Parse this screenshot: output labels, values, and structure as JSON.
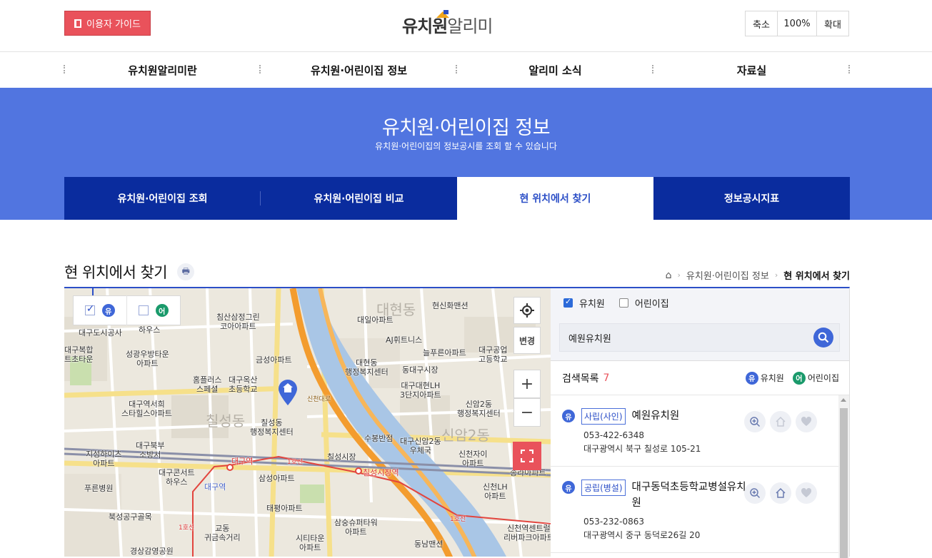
{
  "header": {
    "guide_label": "이용자 가이드",
    "logo_primary": "유치원",
    "logo_secondary": "알리미",
    "zoom_out": "축소",
    "zoom_level": "100%",
    "zoom_in": "확대"
  },
  "gnb": [
    "유치원알리미란",
    "유치원·어린이집 정보",
    "알리미 소식",
    "자료실"
  ],
  "banner": {
    "title": "유치원·어린이집 정보",
    "subtitle": "유치원·어린이집의 정보공시를 조회 할 수 있습니다",
    "tabs": [
      {
        "label": "유치원·어린이집 조회",
        "active": false
      },
      {
        "label": "유치원·어린이집 비교",
        "active": false
      },
      {
        "label": "현 위치에서 찾기",
        "active": true
      },
      {
        "label": "정보공시지표",
        "active": false
      }
    ]
  },
  "page": {
    "title": "현 위치에서 찾기",
    "breadcrumb": [
      "유치원·어린이집 정보",
      "현 위치에서 찾기"
    ]
  },
  "map": {
    "type_toggles": [
      {
        "icon": "유",
        "checked": true
      },
      {
        "icon": "어",
        "checked": false
      }
    ],
    "change_label": "변경",
    "labels": {
      "l1": "대구도시공사",
      "l2": "하우스",
      "l3": "침산삼정그린\n코아아파트",
      "l4": "대일아파트",
      "l5": "현신화맨션",
      "l6": "AJ휘트니스",
      "l7": "대구복합\n트초타운",
      "l8": "성광우방타운\n아파트",
      "l9": "금성아파트",
      "l10": "대현동\n행정복지센터",
      "l11": "늘푸른아파트",
      "l12": "대구공업\n고등학교",
      "l13": "홈플러스\n스페셜",
      "l14": "대구옥산\n초등학교",
      "l15": "동대구시장",
      "l16": "대구대현LH\n3단지아파트",
      "l17": "신암2동\n행정복지센터",
      "l18": "대구역서희\n스타힐스아파트",
      "l19": "칠성동\n행정복지센터",
      "l20": "수봉반점",
      "l21": "대구신암2동\n우체국",
      "l22": "대구북부\n소방서",
      "l23": "지성하이츠\n아파트",
      "l24": "칠성시장",
      "l25": "신천자이\n아파트",
      "l26": "대구콘서트\n하우스",
      "l27": "대구역",
      "l28": "삼성아파트",
      "l29": "칠성시장역",
      "l30": "송라아파트",
      "l31": "신천LH\n아파트",
      "l32": "푸른병원",
      "l33": "태평아파트",
      "l34": "북성공구골목",
      "l35": "교동\n귀금속거리",
      "l36": "삼숭슈퍼타워\n아파트",
      "l37": "신천역센트럴\n리버파크아파트",
      "l38": "시티타운\n아파트",
      "l39": "동남맨션",
      "l40": "경상감영공원",
      "l41": "대구역",
      "l42": "1호선",
      "l43": "1호선",
      "l44": "1호선",
      "l45": "신천대로",
      "l46": "대현동",
      "l47": "칠성동",
      "l48": "신암2동"
    }
  },
  "panel": {
    "filters": [
      {
        "label": "유치원",
        "checked": true
      },
      {
        "label": "어린이집",
        "checked": false
      }
    ],
    "search_value": "예원유치원",
    "result_label": "검색목록",
    "result_count": "7",
    "legend": [
      {
        "icon": "유",
        "label": "유치원"
      },
      {
        "icon": "어",
        "label": "어린이집"
      }
    ],
    "results": [
      {
        "icon": "유",
        "type": "사립(사인)",
        "name": "예원유치원",
        "phone": "053-422-6348",
        "address": "대구광역시 북구 칠성로 105-21"
      },
      {
        "icon": "유",
        "type": "공립(병설)",
        "name": "대구동덕초등학교병설유치원",
        "phone": "053-232-0863",
        "address": "대구광역시 중구 동덕로26길 20"
      }
    ]
  },
  "colors": {
    "accent_blue": "#5175e0",
    "tab_navy": "#0a2c9e",
    "red": "#e9525b",
    "kinder": "#3f67d8",
    "daycare": "#1a9a6b"
  }
}
